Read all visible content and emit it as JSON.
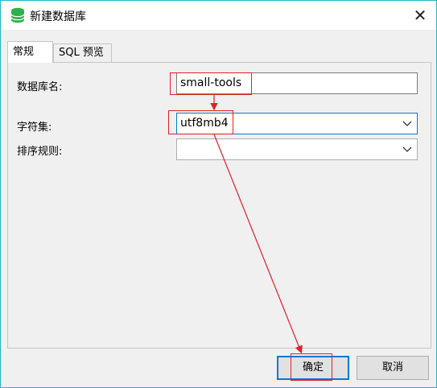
{
  "window": {
    "title": "新建数据库",
    "close_glyph": "✕"
  },
  "tabs": [
    {
      "label": "常规"
    },
    {
      "label": "SQL 预览"
    }
  ],
  "form": {
    "db_name": {
      "label": "数据库名:",
      "value": "small-tools"
    },
    "charset": {
      "label": "字符集:",
      "value": "utf8mb4"
    },
    "collation": {
      "label": "排序规则:",
      "value": ""
    }
  },
  "buttons": {
    "ok": "确定",
    "cancel": "取消"
  },
  "icons": {
    "title": "database-icon",
    "close": "close-icon",
    "dropdown": "chevron-down-icon"
  },
  "colors": {
    "accent": "#0078d7",
    "annotation": "#e0202a",
    "db_icon": "#2db24a"
  }
}
